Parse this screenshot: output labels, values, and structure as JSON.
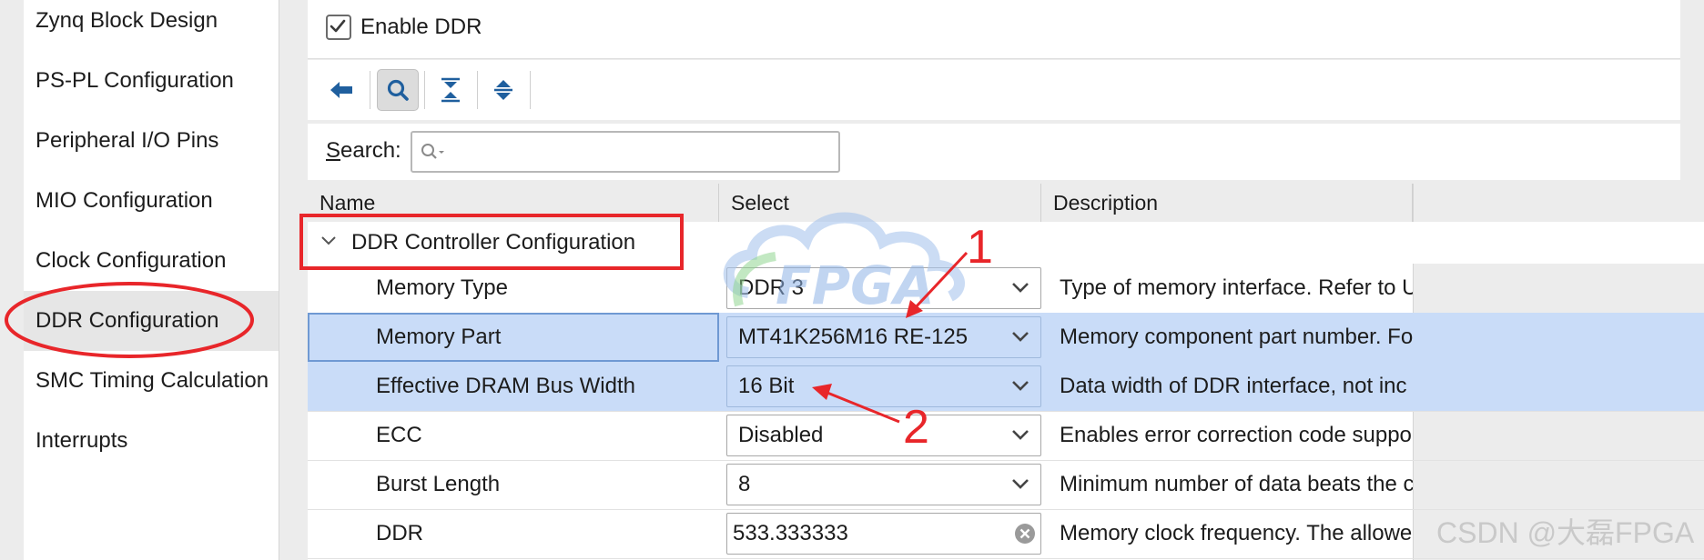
{
  "sidebar": {
    "items": [
      {
        "label": "Zynq Block Design",
        "selected": false
      },
      {
        "label": "PS-PL Configuration",
        "selected": false
      },
      {
        "label": "Peripheral I/O Pins",
        "selected": false
      },
      {
        "label": "MIO Configuration",
        "selected": false
      },
      {
        "label": "Clock Configuration",
        "selected": false
      },
      {
        "label": "DDR Configuration",
        "selected": true
      },
      {
        "label": "SMC Timing Calculation",
        "selected": false
      },
      {
        "label": "Interrupts",
        "selected": false
      }
    ]
  },
  "enable_ddr": {
    "label": "Enable DDR",
    "checked": true
  },
  "toolbar": {
    "icons": [
      "back-arrow-icon",
      "search-icon",
      "collapse-all-icon",
      "expand-all-icon"
    ]
  },
  "search": {
    "label_first": "S",
    "label_rest": "earch:",
    "value": "",
    "placeholder": ""
  },
  "table": {
    "columns": [
      "Name",
      "Select",
      "Description"
    ],
    "group": "DDR Controller Configuration",
    "rows": [
      {
        "name": "Memory Type",
        "select": "DDR 3",
        "description": "Type of memory interface. Refer to U",
        "control": "dropdown"
      },
      {
        "name": "Memory Part",
        "select": "MT41K256M16 RE-125",
        "description": "Memory component part number. Fo",
        "control": "dropdown"
      },
      {
        "name": "Effective DRAM Bus Width",
        "select": "16 Bit",
        "description": "Data width of DDR interface, not inc",
        "control": "dropdown"
      },
      {
        "name": "ECC",
        "select": "Disabled",
        "description": "Enables error correction code suppo",
        "control": "dropdown"
      },
      {
        "name": "Burst Length",
        "select": "8",
        "description": "Minimum number of data beats the c",
        "control": "dropdown"
      },
      {
        "name": "DDR",
        "select": "533.333333",
        "description": "Memory clock frequency. The allowe",
        "control": "text"
      }
    ]
  },
  "annotations": {
    "label_1": "1",
    "label_2": "2",
    "color": "#e8262a"
  },
  "watermark": {
    "text": "CSDN @大磊FPGA"
  },
  "colors": {
    "selection": "#c9dcf8",
    "annotation": "#e8262a"
  }
}
